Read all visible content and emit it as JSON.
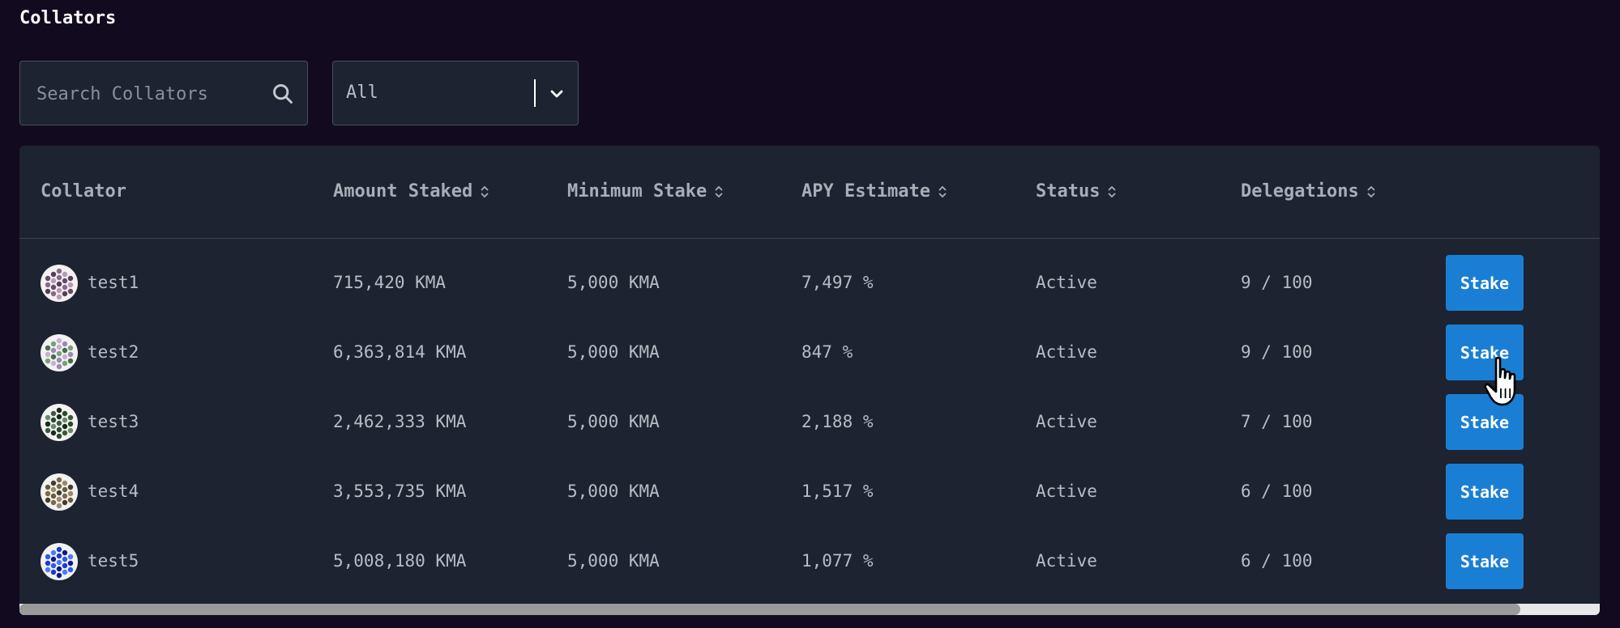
{
  "page": {
    "title": "Collators"
  },
  "search": {
    "placeholder": "Search Collators",
    "value": ""
  },
  "filter": {
    "selected": "All"
  },
  "table": {
    "columns": [
      "Collator",
      "Amount Staked",
      "Minimum Stake",
      "APY Estimate",
      "Status",
      "Delegations"
    ],
    "rows": [
      {
        "name": "test1",
        "amount_staked": "715,420 KMA",
        "minimum_stake": "5,000 KMA",
        "apy": "7,497 %",
        "status": "Active",
        "delegations": "9 / 100",
        "action": "Stake",
        "avatar_colors": [
          "#8a6a8a",
          "#6a4a6a",
          "#b89ab8",
          "#5a3a5a"
        ]
      },
      {
        "name": "test2",
        "amount_staked": "6,363,814 KMA",
        "minimum_stake": "5,000 KMA",
        "apy": "847 %",
        "status": "Active",
        "delegations": "9 / 100",
        "action": "Stake",
        "avatar_colors": [
          "#7aa07a",
          "#c8b0d0",
          "#4a6a4a",
          "#9a8ab0"
        ]
      },
      {
        "name": "test3",
        "amount_staked": "2,462,333 KMA",
        "minimum_stake": "5,000 KMA",
        "apy": "2,188 %",
        "status": "Active",
        "delegations": "7 / 100",
        "action": "Stake",
        "avatar_colors": [
          "#2a4a2a",
          "#3a5a3a",
          "#1a2a1a",
          "#6a8a6a"
        ]
      },
      {
        "name": "test4",
        "amount_staked": "3,553,735 KMA",
        "minimum_stake": "5,000 KMA",
        "apy": "1,517 %",
        "status": "Active",
        "delegations": "6 / 100",
        "action": "Stake",
        "avatar_colors": [
          "#6a5a3a",
          "#9a8a6a",
          "#4a3a2a",
          "#7a6a4a"
        ]
      },
      {
        "name": "test5",
        "amount_staked": "5,008,180 KMA",
        "minimum_stake": "5,000 KMA",
        "apy": "1,077 %",
        "status": "Active",
        "delegations": "6 / 100",
        "action": "Stake",
        "avatar_colors": [
          "#1a3ad0",
          "#2a5af0",
          "#0a1a90",
          "#4a7aff"
        ]
      }
    ]
  },
  "icons": {
    "search": "search-icon",
    "chevron": "chevron-down-icon",
    "sort": "sort-icon",
    "cursor": "hand-pointer-icon"
  },
  "colors": {
    "background": "#120b1f",
    "card": "#1d2330",
    "accent": "#1a7fd4"
  }
}
